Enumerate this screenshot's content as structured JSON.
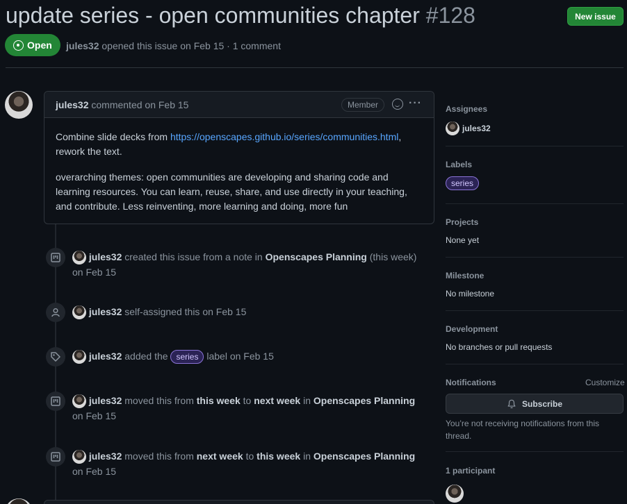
{
  "header": {
    "title": "update series - open communities chapter",
    "number": "#128",
    "new_issue_label": "New issue",
    "status": "Open",
    "author": "jules32",
    "meta_text": "opened this issue on Feb 15 · 1 comment"
  },
  "comment": {
    "author": "jules32",
    "date_text": "commented on Feb 15",
    "role_badge": "Member",
    "body_p1_before": "Combine slide decks from ",
    "body_p1_link": "https://openscapes.github.io/series/communities.html",
    "body_p1_after": ", rework the text.",
    "body_p2": "overarching themes: open communities are developing and sharing code and learning resources. You can learn, reuse, share, and use directly in your teaching, and contribute. Less reinventing, more learning and doing, more fun"
  },
  "timeline": [
    {
      "user": "jules32",
      "t1": "created this issue from a note in",
      "b1": "Openscapes Planning",
      "t2": "(this week)",
      "date": "on Feb 15"
    },
    {
      "user": "jules32",
      "t1": "self-assigned this on Feb 15"
    },
    {
      "user": "jules32",
      "t1": "added the",
      "label": "series",
      "t2": "label on Feb 15"
    },
    {
      "user": "jules32",
      "t1": "moved this from",
      "b1": "this week",
      "t2": "to",
      "b2": "next week",
      "t3": "in",
      "b3": "Openscapes Planning",
      "date": "on Feb 15"
    },
    {
      "user": "jules32",
      "t1": "moved this from",
      "b1": "next week",
      "t2": "to",
      "b2": "this week",
      "t3": "in",
      "b3": "Openscapes Planning",
      "date": "on Feb 15"
    }
  ],
  "sidebar": {
    "assignees_heading": "Assignees",
    "assignee": "jules32",
    "labels_heading": "Labels",
    "label": "series",
    "projects_heading": "Projects",
    "projects_value": "None yet",
    "milestone_heading": "Milestone",
    "milestone_value": "No milestone",
    "development_heading": "Development",
    "development_value": "No branches or pull requests",
    "notifications_heading": "Notifications",
    "customize_label": "Customize",
    "subscribe_label": "Subscribe",
    "notifications_note": "You’re not receiving notifications from this thread.",
    "participants_heading": "1 participant"
  },
  "colors": {
    "accent_green": "#238636",
    "link": "#58a6ff",
    "label_purple": "#8b74d8"
  }
}
